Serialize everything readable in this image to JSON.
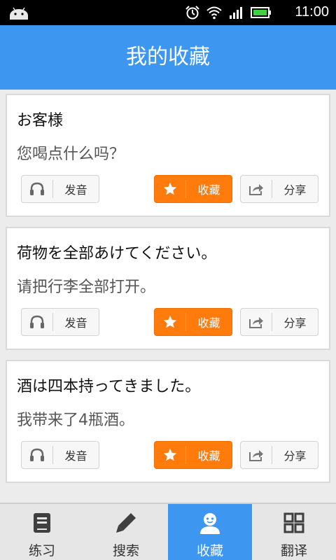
{
  "status_bar": {
    "time": "11:00"
  },
  "header": {
    "title": "我的收藏"
  },
  "cards": [
    {
      "jp": "お客様",
      "cn": "您喝点什么吗？",
      "sound_label": "发音",
      "fav_label": "收藏",
      "share_label": "分享"
    },
    {
      "jp": "荷物を全部あけてください。",
      "cn": "请把行李全部打开。",
      "sound_label": "发音",
      "fav_label": "收藏",
      "share_label": "分享"
    },
    {
      "jp": "酒は四本持ってきました。",
      "cn": "我带来了4瓶酒。",
      "sound_label": "发音",
      "fav_label": "收藏",
      "share_label": "分享"
    }
  ],
  "bottom_nav": [
    {
      "label": "练习",
      "icon": "practice-icon"
    },
    {
      "label": "搜索",
      "icon": "pencil-icon"
    },
    {
      "label": "收藏",
      "icon": "user-icon",
      "active": true
    },
    {
      "label": "翻译",
      "icon": "grid-icon"
    }
  ],
  "colors": {
    "accent_blue": "#3d96f0",
    "favorite_orange": "#ff7b0c"
  }
}
